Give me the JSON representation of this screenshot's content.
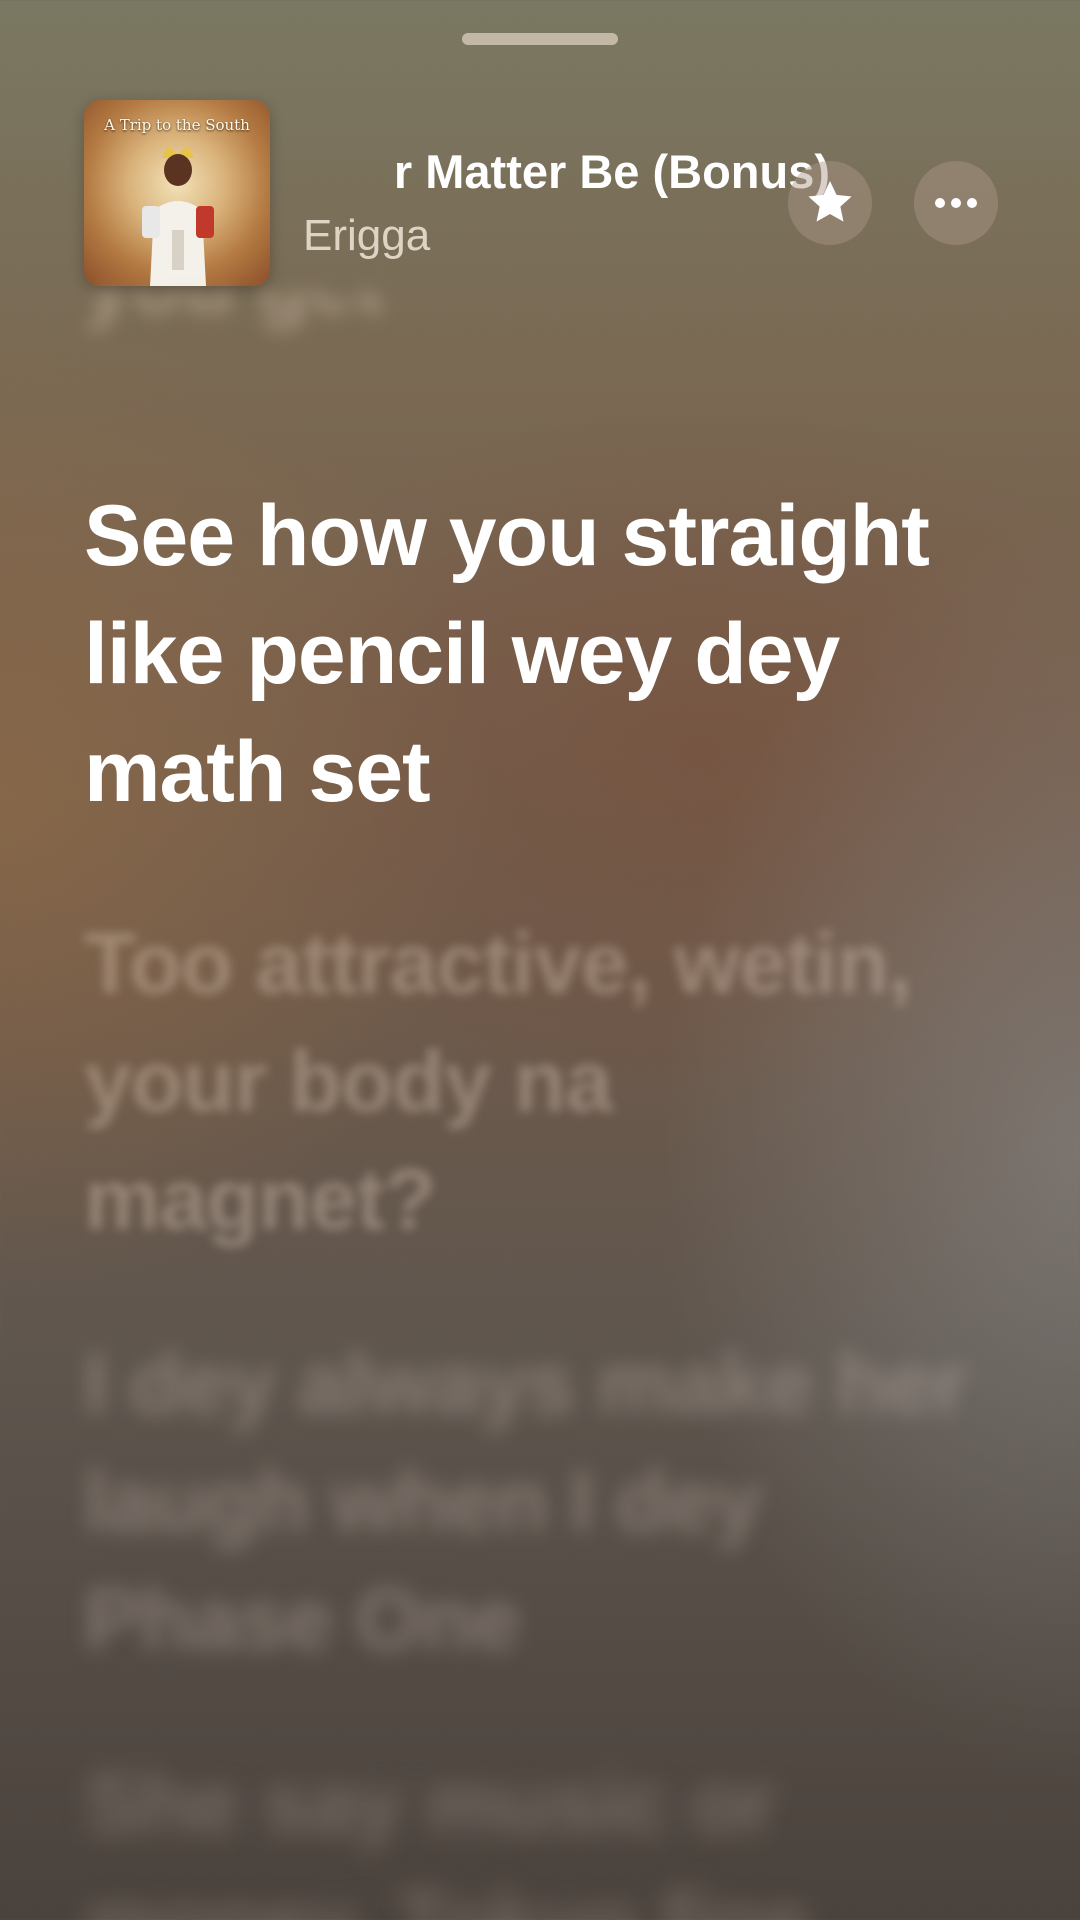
{
  "player": {
    "song_title": "No Matter Be (Bonus)",
    "song_title_visible": "r Matter Be (Bonus)",
    "artist": "Erigga",
    "artwork_text": "A Trip to the South",
    "star_icon": "star-icon",
    "more_icon": "ellipsis-icon"
  },
  "lyrics": {
    "previous": "you get",
    "current": "See how you straight like pencil wey dey math set",
    "next": [
      "Too attractive, wetin, your body na magnet?",
      "I dey always make her laugh when I dey Phase One",
      "She say music or money, Tokyo fine"
    ]
  },
  "colors": {
    "active_lyric": "#ffffff",
    "inactive_lyric": "#d2beaf",
    "background_top": "#7a7862",
    "background_bottom": "#4a423c"
  }
}
